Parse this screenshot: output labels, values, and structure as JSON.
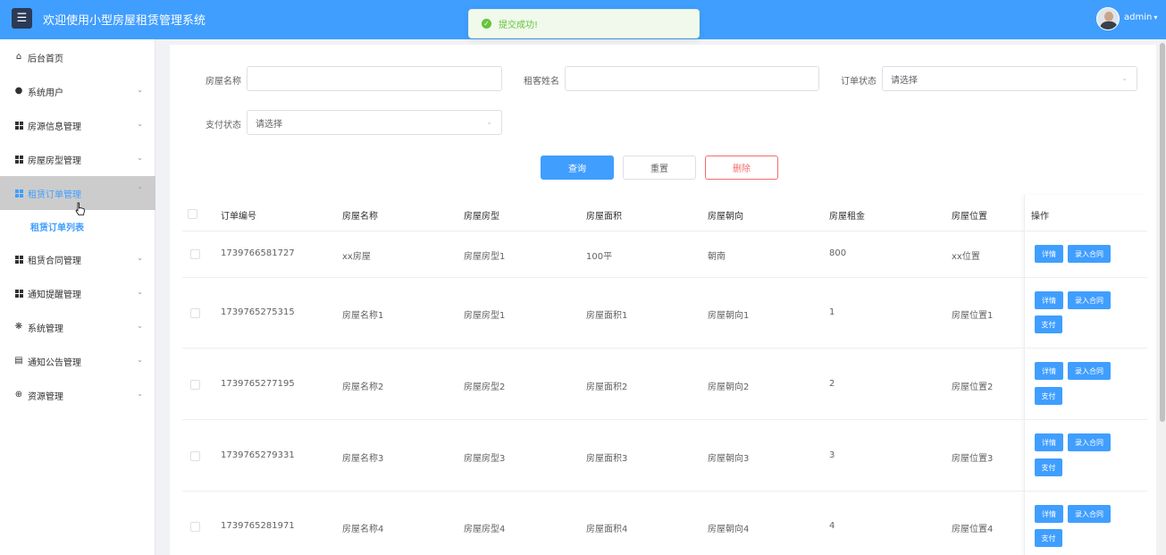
{
  "header": {
    "title": "欢迎使用小型房屋租赁管理系统",
    "menu_icon": "hamburger-icon",
    "user_name": "admin"
  },
  "toast": {
    "message": "提交成功!",
    "color": "#67c23a"
  },
  "sidebar": {
    "items": [
      {
        "label": "后台首页",
        "icon": "home-icon"
      },
      {
        "label": "系统用户",
        "icon": "user-icon"
      },
      {
        "label": "房源信息管理",
        "icon": "grid-icon"
      },
      {
        "label": "房屋房型管理",
        "icon": "grid-icon"
      },
      {
        "label": "租赁订单管理",
        "icon": "grid-icon"
      },
      {
        "label": "租赁订单列表",
        "icon": ""
      },
      {
        "label": "租赁合同管理",
        "icon": "grid-icon"
      },
      {
        "label": "通知提醒管理",
        "icon": "grid-icon"
      },
      {
        "label": "系统管理",
        "icon": "settings-icon"
      },
      {
        "label": "通知公告管理",
        "icon": "document-icon"
      },
      {
        "label": "资源管理",
        "icon": "plus-circle-icon"
      }
    ]
  },
  "filters": {
    "house_name_label": "房屋名称",
    "house_name_value": "",
    "tenant_name_label": "租客姓名",
    "tenant_name_value": "",
    "order_status_label": "订单状态",
    "order_status_placeholder": "请选择",
    "pay_status_label": "支付状态",
    "pay_status_placeholder": "请选择"
  },
  "actions": {
    "query": "查询",
    "reset": "重置",
    "delete": "删除"
  },
  "table": {
    "headers": [
      "订单编号",
      "房屋名称",
      "房屋房型",
      "房屋面积",
      "房屋朝向",
      "房屋租金",
      "房屋位置",
      "操作"
    ],
    "rows": [
      {
        "id": "1739766581727",
        "name": "xx房屋",
        "type": "房屋房型1",
        "area": "100平",
        "orient": "朝南",
        "rent": "800",
        "location": "xx位置",
        "pay": false
      },
      {
        "id": "1739765275315",
        "name": "房屋名称1",
        "type": "房屋房型1",
        "area": "房屋面积1",
        "orient": "房屋朝向1",
        "rent": "1",
        "location": "房屋位置1",
        "pay": true
      },
      {
        "id": "1739765277195",
        "name": "房屋名称2",
        "type": "房屋房型2",
        "area": "房屋面积2",
        "orient": "房屋朝向2",
        "rent": "2",
        "location": "房屋位置2",
        "pay": true
      },
      {
        "id": "1739765279331",
        "name": "房屋名称3",
        "type": "房屋房型3",
        "area": "房屋面积3",
        "orient": "房屋朝向3",
        "rent": "3",
        "location": "房屋位置3",
        "pay": true
      },
      {
        "id": "1739765281971",
        "name": "房屋名称4",
        "type": "房屋房型4",
        "area": "房屋面积4",
        "orient": "房屋朝向4",
        "rent": "4",
        "location": "房屋位置4",
        "pay": true
      }
    ],
    "btn_detail": "详情",
    "btn_contract": "录入合同",
    "btn_pay": "支付"
  },
  "colors": {
    "primary": "#409eff",
    "danger": "#f56c6c",
    "header_bg": "#409eff",
    "sidebar_active_bg": "#cccccc"
  }
}
